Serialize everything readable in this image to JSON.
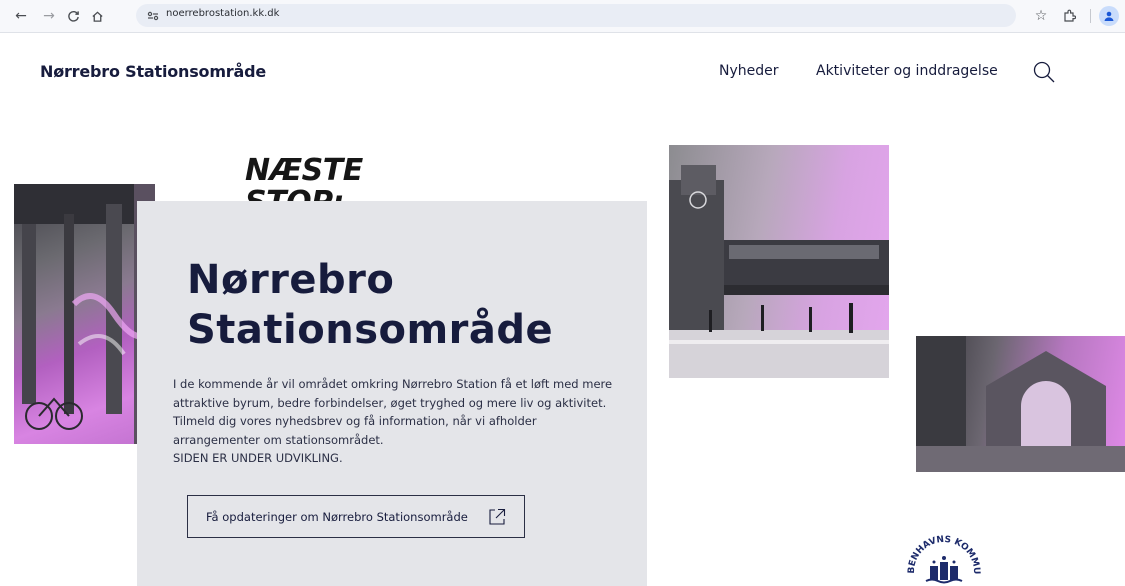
{
  "browser": {
    "url": "noerrebrostation.kk.dk",
    "icons": [
      "back-arrow-icon",
      "forward-arrow-icon",
      "reload-icon",
      "home-icon",
      "site-info-icon",
      "bookmark-star-icon",
      "extensions-icon",
      "profile-icon"
    ]
  },
  "header": {
    "logo": "Nørrebro Stationsområde",
    "nav": [
      {
        "label": "Nyheder"
      },
      {
        "label": "Aktiviteter og inddragelse"
      }
    ],
    "search_icon": "search-icon"
  },
  "hero": {
    "sticker_line1": "NÆSTE",
    "sticker_line2": "STOP:",
    "title_line1": "Nørrebro",
    "title_line2": "Stationsområde",
    "description": "I de kommende år vil området omkring Nørrebro Station få et løft med mere attraktive byrum, bedre forbindelser, øget tryghed og mere liv og aktivitet. Tilmeld dig vores nyhedsbrev og få information, når vi afholder arrangementer om stationsområdet.",
    "status": "SIDEN ER UNDER UDVIKLING.",
    "cta_label": "Få opdateringer om Nørrebro Stationsområde",
    "cta_icon": "external-link-icon"
  },
  "footer_logo": {
    "arc_text": "KØBENHAVNS KOMMUNE",
    "icon": "coat-of-arms-icon"
  },
  "colors": {
    "navy": "#171c3d",
    "card_gray": "#e4e5e9",
    "magenta_tint": "#d884e2"
  }
}
